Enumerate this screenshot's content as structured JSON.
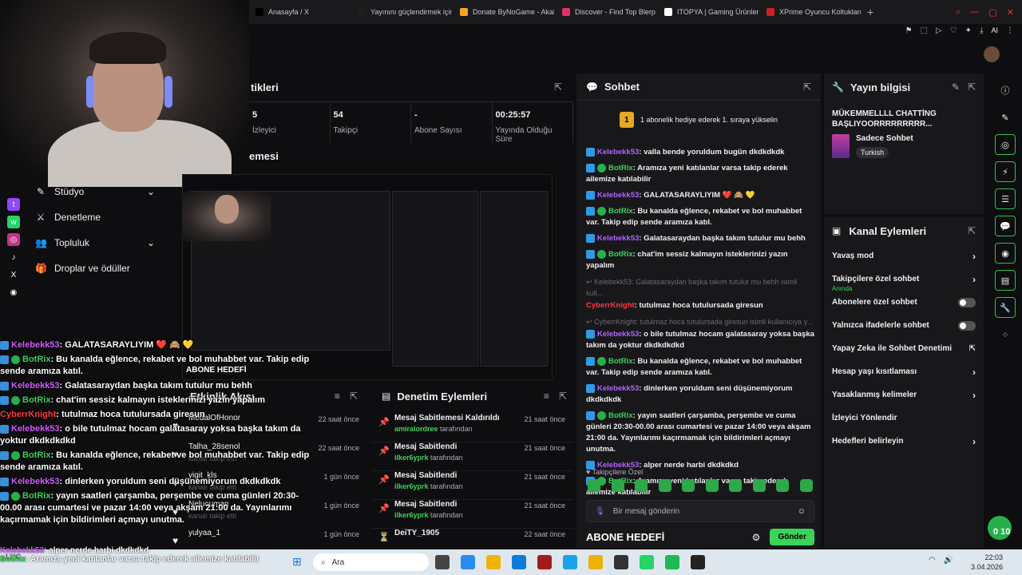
{
  "browser": {
    "tabs": [
      {
        "label": "Anasayfa / X",
        "color": "#000000"
      },
      {
        "label": "Yayınını güçlendirmek için",
        "color": "#1d1d1d"
      },
      {
        "label": "Donate ByNoGame - Akal",
        "color": "#f5a623"
      },
      {
        "label": "Discover - Find Top Blerp",
        "color": "#e0306a"
      },
      {
        "label": "ITOPYA | Gaming Ürünler",
        "color": "#ffffff"
      },
      {
        "label": "XPrime Oyuncu Koltukları",
        "color": "#cc2222"
      }
    ],
    "ai_label": "AI"
  },
  "nav": {
    "items": [
      {
        "label": "Stüdyo",
        "icon": "studio-icon",
        "chevron": true
      },
      {
        "label": "Denetleme",
        "icon": "mod-sword-icon",
        "chevron": false
      },
      {
        "label": "Topluluk",
        "icon": "community-icon",
        "chevron": true
      },
      {
        "label": "Droplar ve ödüller",
        "icon": "gift-icon",
        "chevron": false
      }
    ]
  },
  "stats": {
    "title_partial": "tikleri",
    "items": [
      {
        "value": "5",
        "label": "İzleyici"
      },
      {
        "value": "54",
        "label": "Takipçi"
      },
      {
        "value": "-",
        "label": "Abone Sayısı"
      },
      {
        "value": "00:25:57",
        "label": "Yayında Olduğu Süre"
      }
    ]
  },
  "preview": {
    "title_partial": "emesi",
    "overlay_label": "ABONE HEDEFİ"
  },
  "overlay_chat": [
    {
      "user": "Kelebekk53",
      "cls": "u1",
      "badge": "b",
      "text": ": GALATASARAYLIYIM ❤️ 🙈 💛"
    },
    {
      "user": "BotRix",
      "cls": "u2",
      "badge": "bg",
      "text": ": Bu kanalda eğlence, rekabet ve bol muhabbet var. Takip edip sende aramıza katıl."
    },
    {
      "user": "Kelebekk53",
      "cls": "u1",
      "badge": "b",
      "text": ": Galatasaraydan başka takım tutulur mu behh"
    },
    {
      "user": "BotRix",
      "cls": "u2",
      "badge": "bg",
      "text": ": chat'im sessiz kalmayın isteklerinizi yazın yapalım"
    },
    {
      "user": "CyberrKnight",
      "cls": "u3",
      "badge": "",
      "text": ": tutulmaz hoca tutulursada giresun"
    },
    {
      "user": "Kelebekk53",
      "cls": "u1",
      "badge": "b",
      "text": ": o bile tutulmaz hocam galatasaray yoksa başka takım da yoktur dkdkdkdkd"
    },
    {
      "user": "BotRix",
      "cls": "u2",
      "badge": "bg",
      "text": ": Bu kanalda eğlence, rekabet ve bol muhabbet var. Takip edip sende aramıza katıl."
    },
    {
      "user": "Kelebekk53",
      "cls": "u1",
      "badge": "b",
      "text": ": dinlerken yoruldum seni düşünemiyorum dkdkdkdk"
    },
    {
      "user": "BotRix",
      "cls": "u2",
      "badge": "bg",
      "text": ": yayın saatleri çarşamba, perşembe ve cuma günleri 20:30-00.00 arası cumartesi ve pazar 14:00 veya akşam 21:00 da. Yayınlarımı kaçırmamak için bildirimleri açmayı unutma."
    }
  ],
  "feed": {
    "title": "Etkinlik Akışı",
    "items": [
      {
        "name": "MedalOfHonor",
        "sub": "kanalı takip etti",
        "ago": "22 saat önce"
      },
      {
        "name": "Talha_28senol",
        "sub": "kanalı takip etti",
        "ago": "22 saat önce"
      },
      {
        "name": "yigit_kls",
        "sub": "kanalı takip etti",
        "ago": "1 gün önce"
      },
      {
        "name": "Nelucuman",
        "sub": "kanalı takip etti",
        "ago": "1 gün önce"
      },
      {
        "name": "yulyaa_1",
        "sub": "",
        "ago": "1 gün önce"
      }
    ]
  },
  "mod": {
    "title": "Denetim Eylemleri",
    "items": [
      {
        "action": "Mesaj Sabitlemesi Kaldırıldı",
        "user": "amiralordree",
        "by": "tarafından",
        "ago": "21 saat önce",
        "icon": "unpin-icon"
      },
      {
        "action": "Mesaj Sabitlendi",
        "user": "ilker6yprk",
        "by": "tarafından",
        "ago": "21 saat önce",
        "icon": "pin-icon"
      },
      {
        "action": "Mesaj Sabitlendi",
        "user": "ilker6yprk",
        "by": "tarafından",
        "ago": "21 saat önce",
        "icon": "pin-icon"
      },
      {
        "action": "Mesaj Sabitlendi",
        "user": "ilker6yprk",
        "by": "tarafından",
        "ago": "21 saat önce",
        "icon": "pin-icon"
      },
      {
        "action": "DeiTY_1905",
        "user": "",
        "by": "",
        "ago": "22 saat önce",
        "icon": "filter-icon"
      }
    ]
  },
  "chat": {
    "title": "Sohbet",
    "hype_rank": "1",
    "hype_text": "1 abonelik hediye ederek 1. sıraya yükselin",
    "messages": [
      {
        "kind": "msg",
        "user": "Kelebekk53",
        "cls": "kel",
        "badges": 1,
        "text": ": valla bende yoruldum bugün dkdkdkdk"
      },
      {
        "kind": "msg",
        "user": "BotRix",
        "cls": "bot",
        "badges": 2,
        "text": ": Aramıza yeni katılanlar varsa takip ederek ailemize katılabilir"
      },
      {
        "kind": "msg",
        "user": "Kelebekk53",
        "cls": "kel",
        "badges": 1,
        "text": ": GALATASARAYLIYIM ❤️ 🙈 💛"
      },
      {
        "kind": "msg",
        "user": "BotRix",
        "cls": "bot",
        "badges": 2,
        "text": ": Bu kanalda eğlence, rekabet ve bol muhabbet var. Takip edip sende aramıza katıl."
      },
      {
        "kind": "msg",
        "user": "Kelebekk53",
        "cls": "kel",
        "badges": 1,
        "text": ": Galatasaraydan başka takım tutulur mu behh"
      },
      {
        "kind": "msg",
        "user": "BotRix",
        "cls": "bot",
        "badges": 2,
        "text": ": chat'im sessiz kalmayın isteklerinizi yazın yapalım"
      },
      {
        "kind": "reply",
        "user": "",
        "cls": "",
        "badges": 0,
        "text": "↩ Kelebekk53: Galatasaraydan başka takım tutulur mu behh isimli kull..."
      },
      {
        "kind": "msg",
        "user": "CyberrKnight",
        "cls": "cyb",
        "badges": 0,
        "text": ": tutulmaz hoca tutulursada giresun"
      },
      {
        "kind": "reply",
        "user": "",
        "cls": "",
        "badges": 0,
        "text": "↩ CyberrKnight: tutulmaz hoca tutulursada giresun isimli kullanıcıya y..."
      },
      {
        "kind": "msg",
        "user": "Kelebekk53",
        "cls": "kel",
        "badges": 1,
        "text": ": o bile tutulmaz hocam galatasaray yoksa başka takım da yoktur dkdkdkdkd"
      },
      {
        "kind": "msg",
        "user": "BotRix",
        "cls": "bot",
        "badges": 2,
        "text": ": Bu kanalda eğlence, rekabet ve bol muhabbet var. Takip edip sende aramıza katıl."
      },
      {
        "kind": "msg",
        "user": "Kelebekk53",
        "cls": "kel",
        "badges": 1,
        "text": ": dinlerken yoruldum seni düşünemiyorum dkdkdkdk"
      },
      {
        "kind": "msg",
        "user": "BotRix",
        "cls": "bot",
        "badges": 2,
        "text": ": yayın saatleri çarşamba, perşembe ve cuma günleri 20:30-00.00 arası cumartesi ve pazar 14:00 veya akşam 21:00 da. Yayınlarımı kaçırmamak için bildirimleri açmayı unutma."
      },
      {
        "kind": "msg",
        "user": "Kelebekk53",
        "cls": "kel",
        "badges": 1,
        "text": ": alper nerde harbi dkdkdkd"
      },
      {
        "kind": "msg",
        "user": "BotRix",
        "cls": "bot",
        "badges": 2,
        "text": ": Aramıza yeni katılanlar varsa takip ederek ailemize katılabilir"
      }
    ],
    "follow_only": "♥ Takipçilere Özel",
    "input_placeholder": "Bir mesaj gönderin",
    "abone_label": "ABONE HEDEFİ",
    "send_label": "Gönder"
  },
  "info": {
    "title": "Yayın bilgisi",
    "stream_title": "MÜKEMMELLLL CHATTİNG BAŞLIYOORRRRRRRRR...",
    "category": "Sadece Sohbet",
    "tag": "Turkish"
  },
  "channel": {
    "title": "Kanal Eylemleri",
    "items": [
      {
        "label": "Yavaş mod",
        "control": "chevron",
        "sub": ""
      },
      {
        "label": "Takipçilere özel sohbet",
        "control": "chevron",
        "sub": "Anında"
      },
      {
        "label": "Abonelere özel sohbet",
        "control": "toggle",
        "sub": ""
      },
      {
        "label": "Yalnızca ifadelerle sohbet",
        "control": "toggle",
        "sub": ""
      },
      {
        "label": "Yapay Zeka ile Sohbet Denetimi",
        "control": "external",
        "sub": ""
      },
      {
        "label": "Hesap yaşı kısıtlaması",
        "control": "chevron",
        "sub": ""
      },
      {
        "label": "Yasaklanmış kelimeler",
        "control": "chevron",
        "sub": ""
      },
      {
        "label": "İzleyici Yönlendir",
        "control": "none",
        "sub": ""
      },
      {
        "label": "Hedefleri belirleyin",
        "control": "chevron",
        "sub": ""
      }
    ]
  },
  "live": {
    "count": "0 10"
  },
  "taskbar": {
    "weather": "13°C",
    "search_label": "Ara",
    "time": "22:03",
    "date": "3.04.2026"
  },
  "bottom_overlay": [
    {
      "user": "Kelebekk53",
      "text": ": alper nerde harbi dkdkdkd"
    },
    {
      "user": "BotRix",
      "text": ": Aramıza yeni katılanlar varsa takip ederek ailemize katılabilir"
    }
  ]
}
